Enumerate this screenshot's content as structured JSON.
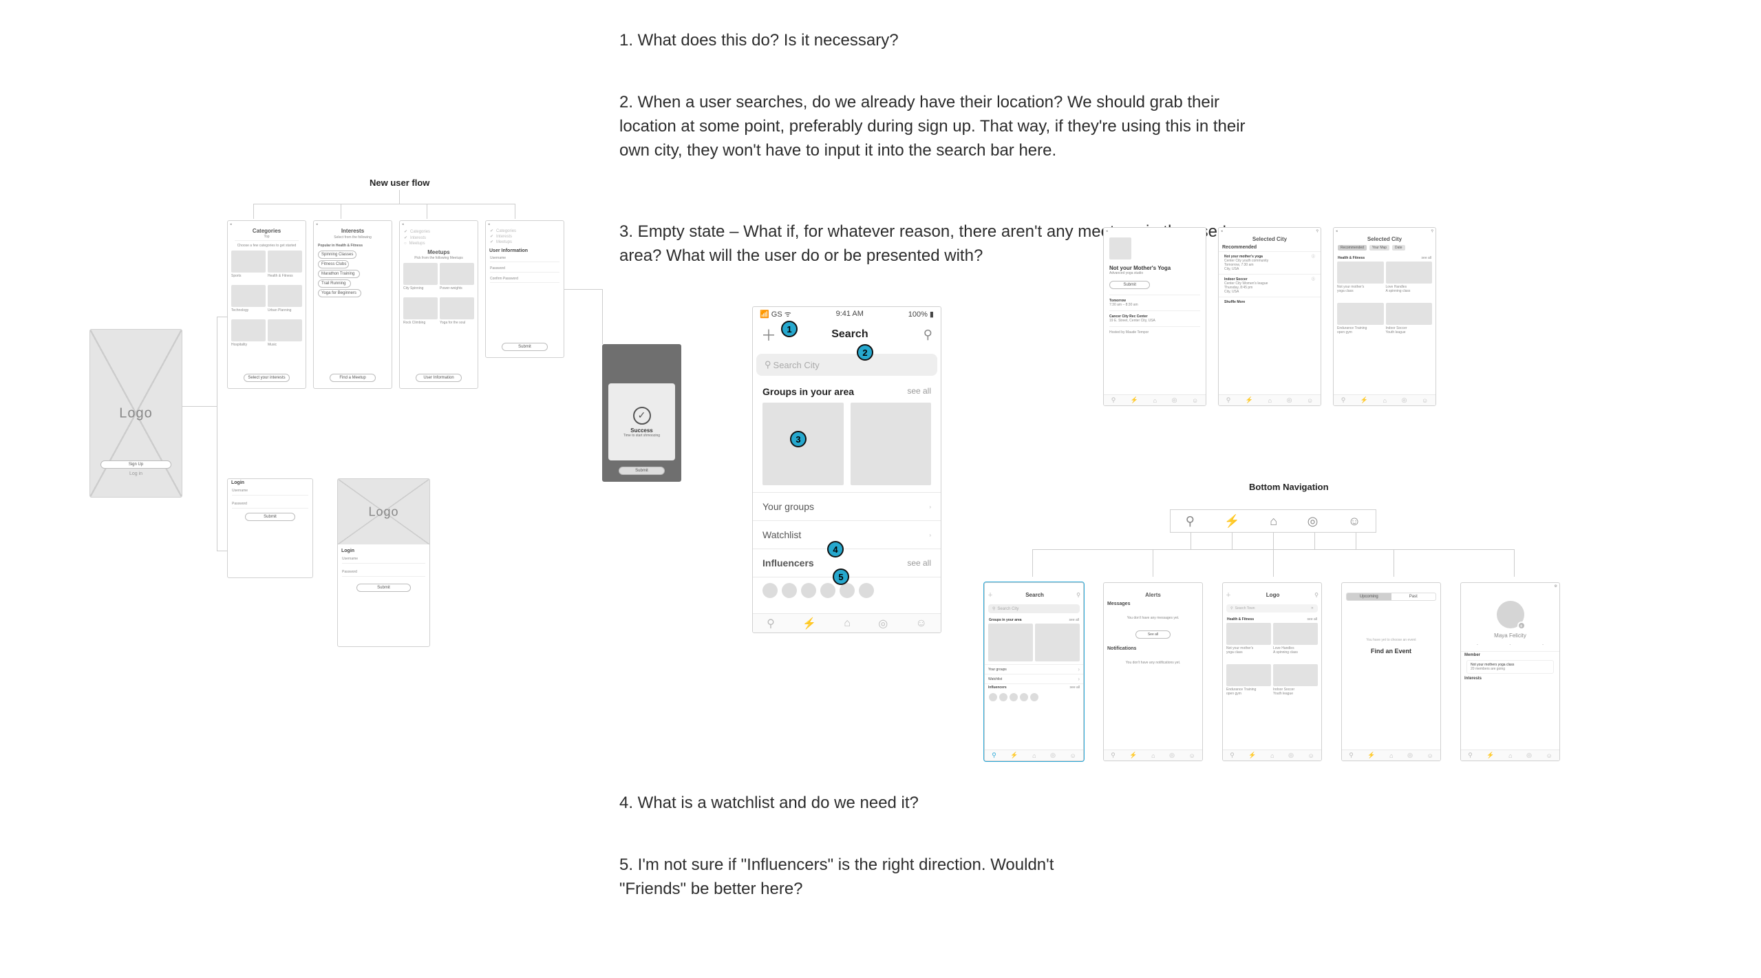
{
  "annotations": {
    "q1": "1. What does this do? Is it necessary?",
    "q2": "2. When a user searches, do we already have their location? We should grab their location at some point, preferably during sign up. That way, if they're using this in their own city, they won't have to input it into the search bar here.",
    "q3": "3. Empty state – What if, for whatever reason, there aren't any meetups in the user's area? What will the user do or be presented with?",
    "q4": "4. What is a watchlist and do we need it?",
    "q5": "5. I'm not sure if \"Influencers\" is the right direction. Wouldn't \"Friends\" be better here?"
  },
  "flows": {
    "new_user": "New user flow",
    "bottom_nav": "Bottom Navigation"
  },
  "status": {
    "carrier": "GS",
    "time": "9:41 AM",
    "battery": "100%"
  },
  "logo": {
    "text": "Logo",
    "signup": "Sign Up",
    "login": "Log in"
  },
  "login": {
    "title": "Login",
    "username": "Username",
    "password": "Password",
    "submit": "Submit"
  },
  "categories": {
    "title": "Categories",
    "tabs_hint": "Top",
    "sub": "Choose a few categories to get started",
    "items": [
      "Sports",
      "Health & Fitness",
      "Technology",
      "Urban Planning",
      "Hospitality",
      "Music"
    ],
    "cta": "Select your interests"
  },
  "interests": {
    "title": "Interests",
    "sub": "Select from the following",
    "section": "Popular in Health & Fitness",
    "items": [
      "Spinning Classes",
      "Fitness Clubs",
      "Marathon Training",
      "Trail Running",
      "Yoga for Beginners"
    ],
    "cta": "Find a Meetup"
  },
  "meetups": {
    "title": "Meetups",
    "sub": "Pick from the following Meetups",
    "items": [
      "City Spinning",
      "Power-weights",
      "Rock Climbing",
      "Yoga for the soul"
    ],
    "cta": "User Information"
  },
  "userinfo": {
    "title": "User Information",
    "fields": [
      "Username",
      "Password",
      "Confirm Password"
    ],
    "cta": "Submit",
    "sidebar": [
      "Categories",
      "Interests",
      "Meetups"
    ]
  },
  "success": {
    "title": "Success",
    "sub": "Time to start shmoozing",
    "cta": "Submit"
  },
  "search": {
    "title": "Search",
    "placeholder": "Search City",
    "groups_header": "Groups in your area",
    "see_all": "see all",
    "rows": [
      "Your groups",
      "Watchlist"
    ],
    "influencers": "Influencers"
  },
  "submit_event": {
    "title": "Not your Mother's Yoga",
    "subtitle": "Advanced yoga studio",
    "cta": "Submit",
    "tomorrow": "Tomorrow",
    "time": "7:30 am – 8:30 am",
    "venue": "Cancer City Rec Center",
    "address": "19 E. Street, Center City, USA",
    "hosted": "Hosted by Maude Tempor"
  },
  "selected_city": {
    "title": "Selected City",
    "rec": "Recommended",
    "cards": [
      {
        "title": "Not your mother's yoga",
        "sub": "Center City youth community",
        "when": "Tomorrow, 7:30 am",
        "where": "City, USA"
      },
      {
        "title": "Indoor Soccer",
        "sub": "Center City Women's league",
        "when": "Thursday, 8:45 pm",
        "where": "City, USA"
      }
    ],
    "more": "Shuffle More"
  },
  "selected_city_grid": {
    "title": "Selected City",
    "chips": [
      "Recommended",
      "Your Map",
      "Date"
    ],
    "section": "Health & Fitness",
    "tiles": [
      {
        "a": "Not your mother's",
        "b": "yoga class"
      },
      {
        "a": "Love Handles",
        "b": "A spinning class"
      },
      {
        "a": "Endurance Training",
        "b": "open gym"
      },
      {
        "a": "Indoor Soccer",
        "b": "Youth league"
      }
    ]
  },
  "alerts": {
    "title": "Alerts",
    "messages": "Messages",
    "messages_empty": "You don't have any messages yet.",
    "see_all": "See all",
    "notifications": "Notifications",
    "notifications_empty": "You don't have any notifications yet."
  },
  "home_logo": {
    "title": "Logo",
    "section": "Health & Fitness",
    "see_all": "see all",
    "search_ph": "Search Town",
    "tiles": [
      {
        "a": "Not your mother's",
        "b": "yoga class"
      },
      {
        "a": "Love Handles",
        "b": "A spinning class"
      },
      {
        "a": "Endurance Training",
        "b": "open gym"
      },
      {
        "a": "Indoor Soccer",
        "b": "Youth league"
      }
    ]
  },
  "calendar": {
    "tabs": [
      "Upcoming",
      "Past"
    ],
    "empty": "You have yet to choose an event",
    "cta": "Find an Event"
  },
  "profile": {
    "name": "Maya Felicity",
    "member": "Member",
    "card": "Not your mothers yoga class",
    "card_sub": "20 members are going",
    "interests": "Interests"
  },
  "nav_icons": [
    "search-icon",
    "bolt-icon",
    "home-icon",
    "people-icon",
    "user-icon"
  ],
  "badges": [
    "1",
    "2",
    "3",
    "4",
    "5"
  ]
}
